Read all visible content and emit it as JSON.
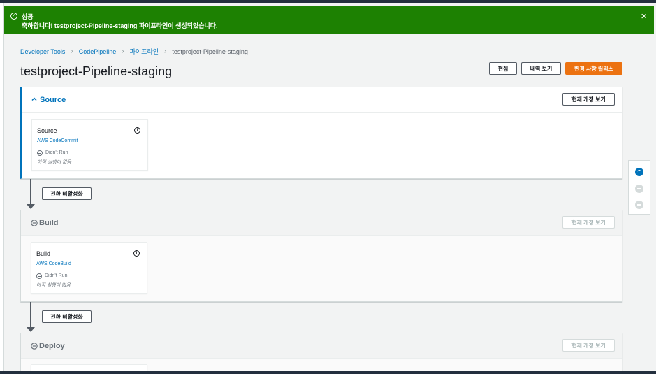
{
  "flash": {
    "title": "성공",
    "message": "축하합니다! testproject-Pipeline-staging 파이프라인이 생성되었습니다.",
    "close_icon": "×"
  },
  "breadcrumb": {
    "items": [
      "Developer Tools",
      "CodePipeline",
      "파이프라인"
    ],
    "current": "testproject-Pipeline-staging"
  },
  "page": {
    "title": "testproject-Pipeline-staging"
  },
  "header_buttons": {
    "edit": "편집",
    "history": "내역 보기",
    "release": "변경 사항 릴리스"
  },
  "stages": [
    {
      "name": "Source",
      "view_button": "현재 개정 보기",
      "action": {
        "name": "Source",
        "provider": "AWS CodeCommit",
        "status": "Didn't Run",
        "note": "아직 실행이 없음"
      }
    },
    {
      "name": "Build",
      "view_button": "현재 개정 보기",
      "action": {
        "name": "Build",
        "provider": "AWS CodeBuild",
        "status": "Didn't Run",
        "note": "아직 실행이 없음"
      }
    },
    {
      "name": "Deploy",
      "view_button": "현재 개정 보기"
    }
  ],
  "transitions": [
    {
      "button": "전환 비활성화"
    },
    {
      "button": "전환 비활성화"
    }
  ],
  "colors": {
    "success": "#1d8102",
    "primary": "#ec7211",
    "link": "#0073bb"
  }
}
